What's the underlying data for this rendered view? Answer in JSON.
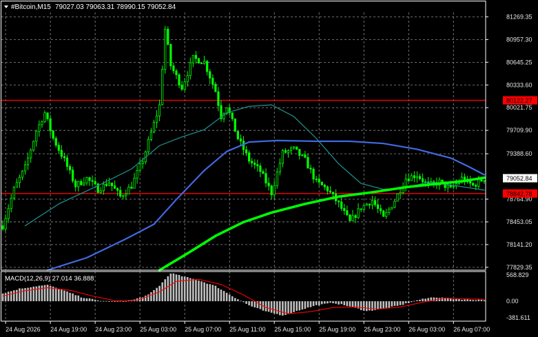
{
  "header": {
    "symbol": "#Bitcoin,M15",
    "ohlc": "79027.03 79063.31 78990.15 79052.84"
  },
  "macd_label": "MACD(12,26,9) 27.014 36.888",
  "colors": {
    "background": "#000000",
    "grid": "#c0c0c0",
    "candles": "#00ff00",
    "ma_fast": "#1f8a8a",
    "ma_mid": "#4169e1",
    "ma_slow": "#00ff00",
    "hline": "#ff0000",
    "macd_hist": "#c0c0c0",
    "macd_signal": "#ff0000"
  },
  "chart_data": {
    "type": "candlestick",
    "symbol": "#Bitcoin",
    "timeframe": "M15",
    "y_ticks": [
      "81269.35",
      "80957.30",
      "80645.25",
      "80333.60",
      "80021.75",
      "79709.90",
      "79388.60",
      "78764.90",
      "78453.05",
      "78141.20",
      "77829.35"
    ],
    "ylim": [
      77790,
      81330
    ],
    "x_ticks": [
      "24 Aug 2026",
      "24 Aug 19:00",
      "24 Aug 23:00",
      "25 Aug 03:00",
      "25 Aug 07:00",
      "25 Aug 11:00",
      "25 Aug 15:00",
      "25 Aug 19:00",
      "25 Aug 23:00",
      "26 Aug 03:00",
      "26 Aug 07:00"
    ],
    "horizontal_lines": [
      {
        "price": 80122.27,
        "label": "80122.27"
      },
      {
        "price": 78842.78,
        "label": "78842.78"
      }
    ],
    "current_price": {
      "price": 79052.84,
      "label": "79052.84"
    },
    "price_path": [
      [
        0,
        78400
      ],
      [
        4,
        78900
      ],
      [
        8,
        79200
      ],
      [
        12,
        79700
      ],
      [
        15,
        79950
      ],
      [
        18,
        79600
      ],
      [
        22,
        79300
      ],
      [
        26,
        78950
      ],
      [
        30,
        79050
      ],
      [
        34,
        78900
      ],
      [
        38,
        79000
      ],
      [
        42,
        78800
      ],
      [
        46,
        78950
      ],
      [
        50,
        79300
      ],
      [
        54,
        79800
      ],
      [
        56,
        80050
      ],
      [
        58,
        81100
      ],
      [
        60,
        80600
      ],
      [
        64,
        80300
      ],
      [
        68,
        80700
      ],
      [
        72,
        80650
      ],
      [
        76,
        80250
      ],
      [
        78,
        79900
      ],
      [
        80,
        80050
      ],
      [
        84,
        79600
      ],
      [
        88,
        79300
      ],
      [
        92,
        79150
      ],
      [
        96,
        78850
      ],
      [
        100,
        79400
      ],
      [
        104,
        79450
      ],
      [
        108,
        79300
      ],
      [
        112,
        79000
      ],
      [
        116,
        78900
      ],
      [
        120,
        78700
      ],
      [
        124,
        78450
      ],
      [
        128,
        78650
      ],
      [
        132,
        78750
      ],
      [
        136,
        78500
      ],
      [
        140,
        78750
      ],
      [
        144,
        79050
      ],
      [
        148,
        79100
      ],
      [
        152,
        78950
      ],
      [
        156,
        79000
      ],
      [
        160,
        78900
      ],
      [
        164,
        79050
      ],
      [
        168,
        78950
      ],
      [
        172,
        79052
      ]
    ],
    "ma_series": [
      {
        "key": "fast",
        "color": "#1f8a8a",
        "width": 1.3,
        "path": [
          [
            8,
            78400
          ],
          [
            20,
            78700
          ],
          [
            34,
            78950
          ],
          [
            46,
            79180
          ],
          [
            56,
            79500
          ],
          [
            64,
            79620
          ],
          [
            72,
            79720
          ],
          [
            80,
            79950
          ],
          [
            88,
            80040
          ],
          [
            96,
            80060
          ],
          [
            104,
            79900
          ],
          [
            112,
            79600
          ],
          [
            120,
            79250
          ],
          [
            128,
            78980
          ],
          [
            136,
            78900
          ],
          [
            144,
            78920
          ],
          [
            152,
            79000
          ],
          [
            160,
            78960
          ],
          [
            172,
            78890
          ]
        ]
      },
      {
        "key": "mid",
        "color": "#4169e1",
        "width": 2.2,
        "path": [
          [
            16,
            77790
          ],
          [
            30,
            77960
          ],
          [
            44,
            78220
          ],
          [
            54,
            78420
          ],
          [
            62,
            78760
          ],
          [
            72,
            79160
          ],
          [
            80,
            79420
          ],
          [
            88,
            79550
          ],
          [
            98,
            79570
          ],
          [
            112,
            79560
          ],
          [
            124,
            79560
          ],
          [
            136,
            79530
          ],
          [
            148,
            79450
          ],
          [
            160,
            79330
          ],
          [
            166,
            79220
          ],
          [
            172,
            79100
          ]
        ]
      },
      {
        "key": "slow",
        "color": "#00ff00",
        "width": 3.6,
        "path": [
          [
            56,
            77790
          ],
          [
            66,
            78020
          ],
          [
            76,
            78260
          ],
          [
            86,
            78450
          ],
          [
            96,
            78580
          ],
          [
            108,
            78700
          ],
          [
            120,
            78800
          ],
          [
            132,
            78860
          ],
          [
            144,
            78930
          ],
          [
            156,
            78980
          ],
          [
            164,
            79010
          ],
          [
            172,
            79060
          ]
        ]
      }
    ],
    "macd": {
      "yticks": [
        "568.829",
        "0.00",
        "-381.611"
      ],
      "ylim": [
        -381.611,
        568.829
      ],
      "hist_path": [
        [
          0,
          150
        ],
        [
          6,
          240
        ],
        [
          12,
          290
        ],
        [
          16,
          310
        ],
        [
          22,
          200
        ],
        [
          28,
          80
        ],
        [
          34,
          15
        ],
        [
          40,
          -15
        ],
        [
          46,
          15
        ],
        [
          52,
          120
        ],
        [
          56,
          300
        ],
        [
          60,
          540
        ],
        [
          64,
          480
        ],
        [
          70,
          400
        ],
        [
          76,
          290
        ],
        [
          82,
          100
        ],
        [
          88,
          -80
        ],
        [
          94,
          -200
        ],
        [
          100,
          -270
        ],
        [
          106,
          -170
        ],
        [
          112,
          -80
        ],
        [
          118,
          -30
        ],
        [
          124,
          -100
        ],
        [
          130,
          -190
        ],
        [
          136,
          -140
        ],
        [
          142,
          -80
        ],
        [
          148,
          20
        ],
        [
          154,
          80
        ],
        [
          160,
          50
        ],
        [
          166,
          30
        ],
        [
          172,
          27
        ]
      ],
      "signal_path": [
        [
          0,
          100
        ],
        [
          8,
          200
        ],
        [
          16,
          260
        ],
        [
          24,
          210
        ],
        [
          32,
          100
        ],
        [
          40,
          10
        ],
        [
          48,
          20
        ],
        [
          56,
          180
        ],
        [
          62,
          380
        ],
        [
          70,
          420
        ],
        [
          78,
          320
        ],
        [
          86,
          120
        ],
        [
          94,
          -120
        ],
        [
          102,
          -240
        ],
        [
          110,
          -200
        ],
        [
          118,
          -120
        ],
        [
          126,
          -110
        ],
        [
          134,
          -150
        ],
        [
          142,
          -110
        ],
        [
          150,
          -20
        ],
        [
          158,
          60
        ],
        [
          166,
          45
        ],
        [
          172,
          37
        ]
      ]
    }
  }
}
